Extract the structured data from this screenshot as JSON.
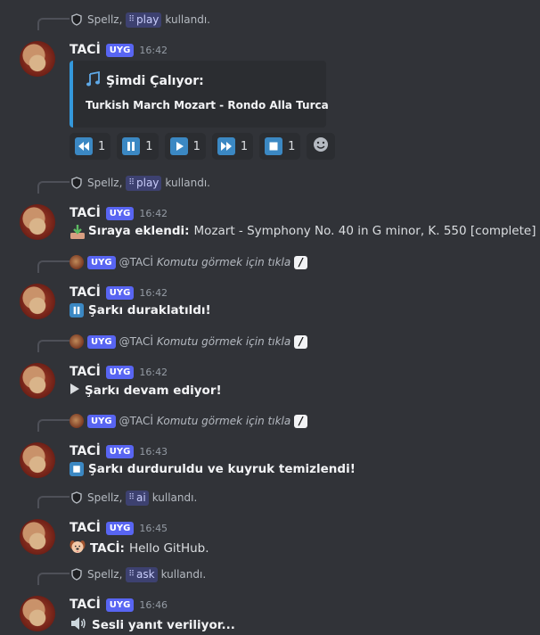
{
  "messages": [
    {
      "reply": {
        "invoker": "Spellz,",
        "command": "play",
        "suffix": "kullandı."
      },
      "author": "TACİ",
      "badge": "UYG",
      "time": "16:42",
      "embed": {
        "title": "Şimdi Çalıyor:",
        "description": "Turkish March Mozart - Rondo Alla Turca"
      },
      "buttons": [
        {
          "icon": "rewind-icon",
          "count": "1"
        },
        {
          "icon": "pause-icon",
          "count": "1"
        },
        {
          "icon": "play-icon",
          "count": "1"
        },
        {
          "icon": "fast-forward-icon",
          "count": "1"
        },
        {
          "icon": "stop-icon",
          "count": "1"
        },
        {
          "icon": "add-reaction-icon"
        }
      ]
    },
    {
      "reply": {
        "invoker": "Spellz,",
        "command": "play",
        "suffix": "kullandı."
      },
      "author": "TACİ",
      "badge": "UYG",
      "time": "16:42",
      "content": {
        "bold": "Sıraya eklendi:",
        "text": "Mozart - Symphony No. 40 in G minor, K. 550 [complete]"
      }
    },
    {
      "reply": {
        "badge": "UYG",
        "mention": "@TACİ",
        "hint": "Komutu görmek için tıkla"
      },
      "author": "TACİ",
      "badge": "UYG",
      "time": "16:42",
      "content": {
        "bold": "Şarkı duraklatıldı!"
      }
    },
    {
      "reply": {
        "badge": "UYG",
        "mention": "@TACİ",
        "hint": "Komutu görmek için tıkla"
      },
      "author": "TACİ",
      "badge": "UYG",
      "time": "16:42",
      "content": {
        "bold": "Şarkı devam ediyor!"
      }
    },
    {
      "reply": {
        "badge": "UYG",
        "mention": "@TACİ",
        "hint": "Komutu görmek için tıkla"
      },
      "author": "TACİ",
      "badge": "UYG",
      "time": "16:43",
      "content": {
        "bold": "Şarkı durduruldu ve kuyruk temizlendi!"
      }
    },
    {
      "reply": {
        "invoker": "Spellz,",
        "command": "ai",
        "suffix": "kullandı."
      },
      "author": "TACİ",
      "badge": "UYG",
      "time": "16:45",
      "content": {
        "bold": "TACİ:",
        "text": "Hello GitHub."
      }
    },
    {
      "reply": {
        "invoker": "Spellz,",
        "command": "ask",
        "suffix": "kullandı."
      },
      "author": "TACİ",
      "badge": "UYG",
      "time": "16:46",
      "content": {
        "bold": "Sesli yanıt veriliyor..."
      }
    }
  ],
  "colors": {
    "background": "#313338",
    "accent": "#5865f2",
    "embed_border": "#3498db",
    "button_blue": "#3b88c3"
  }
}
